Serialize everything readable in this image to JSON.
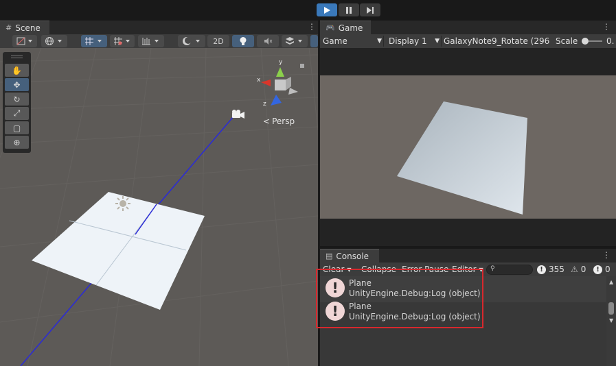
{
  "playbar": {
    "play_icon": "play-icon",
    "pause_icon": "pause-icon",
    "step_icon": "step-icon"
  },
  "scene": {
    "tab_label": "Scene",
    "btn_2d": "2D",
    "persp_label": "Persp",
    "axis_x": "x",
    "axis_y": "y",
    "axis_z": "z"
  },
  "game": {
    "tab_label": "Game",
    "view_mode": "Game",
    "display": "Display 1",
    "resolution": "GalaxyNote9_Rotate (296",
    "scale_label": "Scale",
    "scale_value": "0."
  },
  "console": {
    "tab_label": "Console",
    "clear": "Clear",
    "collapse": "Collapse",
    "error_pause": "Error Pause",
    "editor": "Editor",
    "search_placeholder": "",
    "error_count": "355",
    "warning_count": "0",
    "info_count": "0",
    "logs": [
      {
        "line1": "Plane",
        "line2": "UnityEngine.Debug:Log (object)"
      },
      {
        "line1": "Plane",
        "line2": "UnityEngine.Debug:Log (object)"
      }
    ]
  },
  "colors": {
    "accent_blue": "#3a79bb",
    "highlight_red": "#d8282d"
  }
}
